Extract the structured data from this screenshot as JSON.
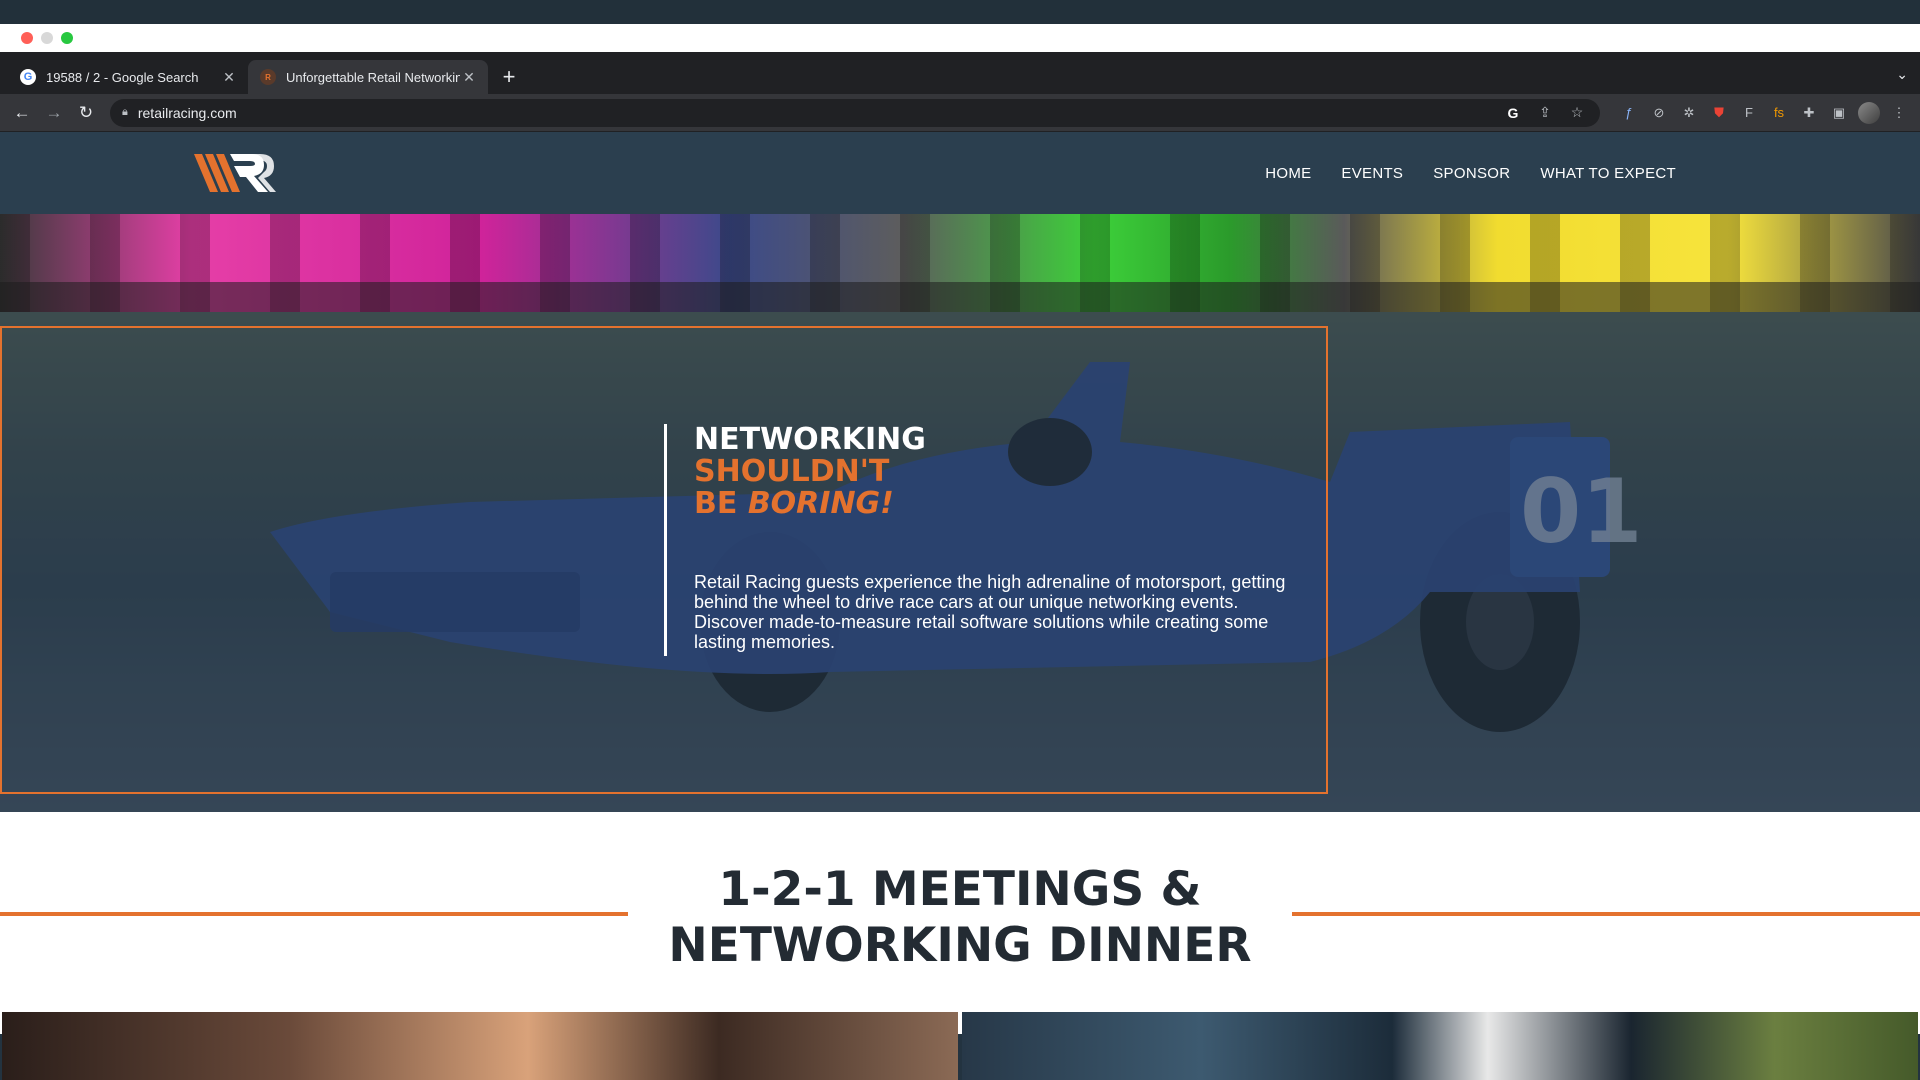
{
  "browser": {
    "tabs": [
      {
        "title": "19588 / 2 - Google Search",
        "favicon": "google-icon",
        "active": false
      },
      {
        "title": "Unforgettable Retail Networkin",
        "favicon": "retailracing-icon",
        "active": true
      }
    ],
    "new_tab": "+",
    "url": "retailracing.com"
  },
  "site": {
    "nav": [
      "HOME",
      "EVENTS",
      "SPONSOR",
      "WHAT TO EXPECT"
    ],
    "hero": {
      "line1": "NETWORKING",
      "line2": "SHOULDN'T",
      "line3_prefix": "BE ",
      "line3_emph": "BORING!",
      "paragraph": "Retail Racing guests experience the high adrenaline of motorsport, getting behind the wheel to drive race cars at our unique networking events. Discover made-to-measure retail software solutions while creating some lasting memories."
    },
    "section_heading_line1": "1-2-1 MEETINGS &",
    "section_heading_line2": "NETWORKING DINNER"
  },
  "colors": {
    "accent": "#e4722e",
    "header_bg": "#2b3f4f",
    "heading_text": "#232b33"
  }
}
